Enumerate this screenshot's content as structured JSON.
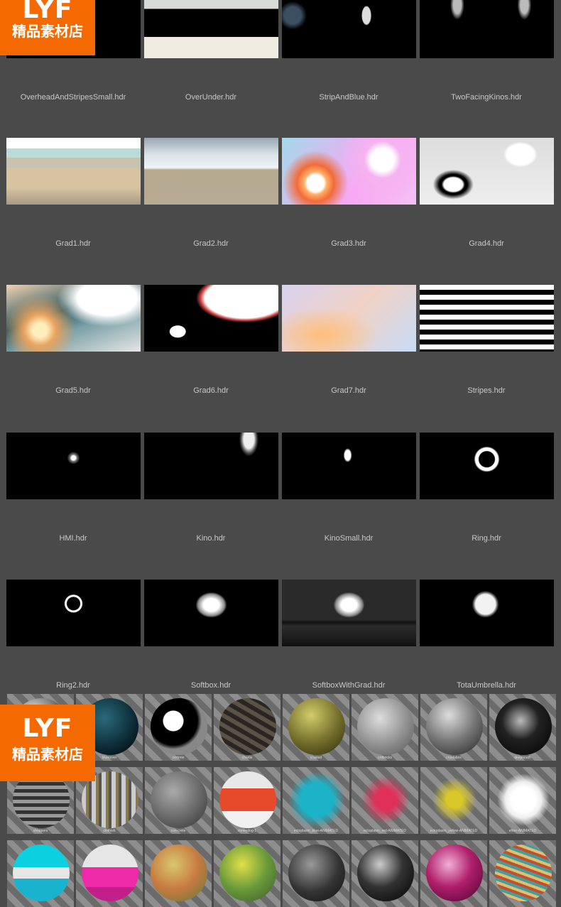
{
  "hdri_rows": [
    [
      "OverheadAndStripesSmall.hdr",
      "OverUnder.hdr",
      "StripAndBlue.hdr",
      "TwoFacingKinos.hdr"
    ],
    [
      "Grad1.hdr",
      "Grad2.hdr",
      "Grad3.hdr",
      "Grad4.hdr"
    ],
    [
      "Grad5.hdr",
      "Grad6.hdr",
      "Grad7.hdr",
      "Stripes.hdr"
    ],
    [
      "HMI.hdr",
      "Kino.hdr",
      "KinoSmall.hdr",
      "Ring.hdr"
    ],
    [
      "Ring2.hdr",
      "Softbox.hdr",
      "SoftboxWithGrad.hdr",
      "TotaUmbrella.hdr"
    ]
  ],
  "materials": [
    [
      "",
      "bluerover",
      "certone",
      "charlie",
      "crasted",
      "crdbricks",
      "crustabox",
      "deepsouth"
    ],
    [
      "choppers",
      "clothish",
      "con-crete",
      "coneydog-1",
      "ectoplasm_blue-ANIMATED",
      "ectoplasm_red-ANIMATED",
      "ectoplasm_yellow-ANIMATED",
      "ehter-ANIMATED"
    ],
    [
      "",
      "",
      "",
      "",
      "",
      "",
      "",
      ""
    ]
  ],
  "watermark": {
    "big": "LYF",
    "small": "精品素材店"
  }
}
